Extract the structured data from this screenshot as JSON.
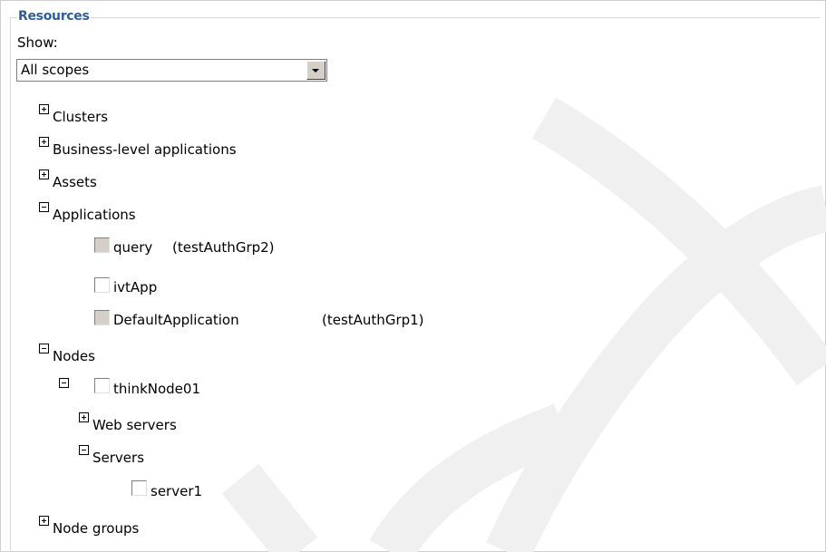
{
  "panel": {
    "title": "Resources",
    "show_label": "Show:",
    "scope_select": {
      "value": "All scopes"
    }
  },
  "tree": {
    "clusters": "Clusters",
    "business_apps": "Business-level applications",
    "assets": "Assets",
    "applications": "Applications",
    "app_query": "query",
    "app_query_group": "(testAuthGrp2)",
    "app_ivtapp": "ivtApp",
    "app_default": "DefaultApplication",
    "app_default_group": "(testAuthGrp1)",
    "nodes": "Nodes",
    "node_think": "thinkNode01",
    "web_servers": "Web servers",
    "servers": "Servers",
    "server1": "server1",
    "node_groups": "Node groups"
  },
  "colors": {
    "title": "#2f5d9c",
    "watermark": "#f0f0f0"
  }
}
